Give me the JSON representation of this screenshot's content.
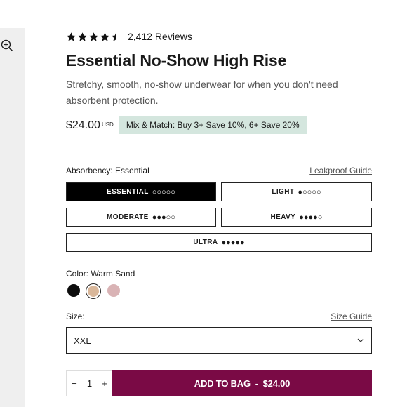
{
  "gallery": {
    "zoom_icon": "zoom-in-icon"
  },
  "rating": {
    "stars": 4.5,
    "reviews_label": "2,412 Reviews"
  },
  "product": {
    "title": "Essential No-Show High Rise",
    "description": "Stretchy, smooth, no-show underwear for when you don't need absorbent protection.",
    "price": "$24.00",
    "currency": "USD",
    "promo": "Mix & Match: Buy 3+ Save 10%, 6+ Save 20%"
  },
  "absorbency": {
    "label": "Absorbency: Essential",
    "guide_link": "Leakproof Guide",
    "options": [
      {
        "label": "ESSENTIAL",
        "drops": "00000",
        "selected": true
      },
      {
        "label": "LIGHT",
        "drops": "10000",
        "selected": false
      },
      {
        "label": "MODERATE",
        "drops": "11100",
        "selected": false
      },
      {
        "label": "HEAVY",
        "drops": "11110",
        "selected": false
      },
      {
        "label": "ULTRA",
        "drops": "11111",
        "selected": false
      }
    ]
  },
  "color": {
    "label": "Color: Warm Sand",
    "swatches": [
      {
        "name": "black",
        "hex": "#0d0d0d",
        "selected": false
      },
      {
        "name": "warm-sand",
        "hex": "#d9b79a",
        "selected": true
      },
      {
        "name": "pink",
        "hex": "#d9b3b5",
        "selected": false
      }
    ]
  },
  "size": {
    "label": "Size:",
    "guide_link": "Size Guide",
    "selected": "XXL",
    "chevron_icon": "chevron-down-icon"
  },
  "cart": {
    "minus": "−",
    "quantity": "1",
    "plus": "+",
    "add_label": "ADD TO BAG  -  $24.00",
    "button_color": "#7a0a45"
  }
}
